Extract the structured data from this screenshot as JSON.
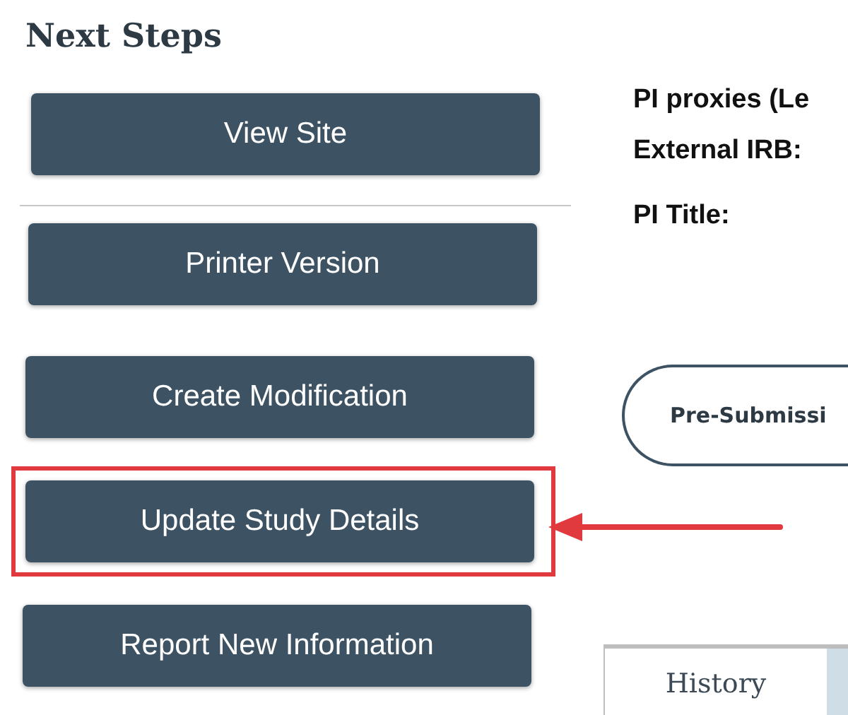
{
  "next_steps": {
    "title": "Next Steps",
    "buttons": [
      {
        "label": "View Site",
        "highlighted": false
      },
      {
        "label": "Printer Version",
        "highlighted": false
      },
      {
        "label": "Create Modification",
        "highlighted": false
      },
      {
        "label": "Update Study Details",
        "highlighted": true
      },
      {
        "label": "Report New Information",
        "highlighted": false
      }
    ]
  },
  "details": {
    "fields": [
      "PI proxies (Le",
      "External IRB:",
      "PI Title:"
    ]
  },
  "state_pill": {
    "label": "Pre-Submissi"
  },
  "tabs": [
    {
      "label": "History",
      "selected": true
    },
    {
      "selected": false
    }
  ]
}
